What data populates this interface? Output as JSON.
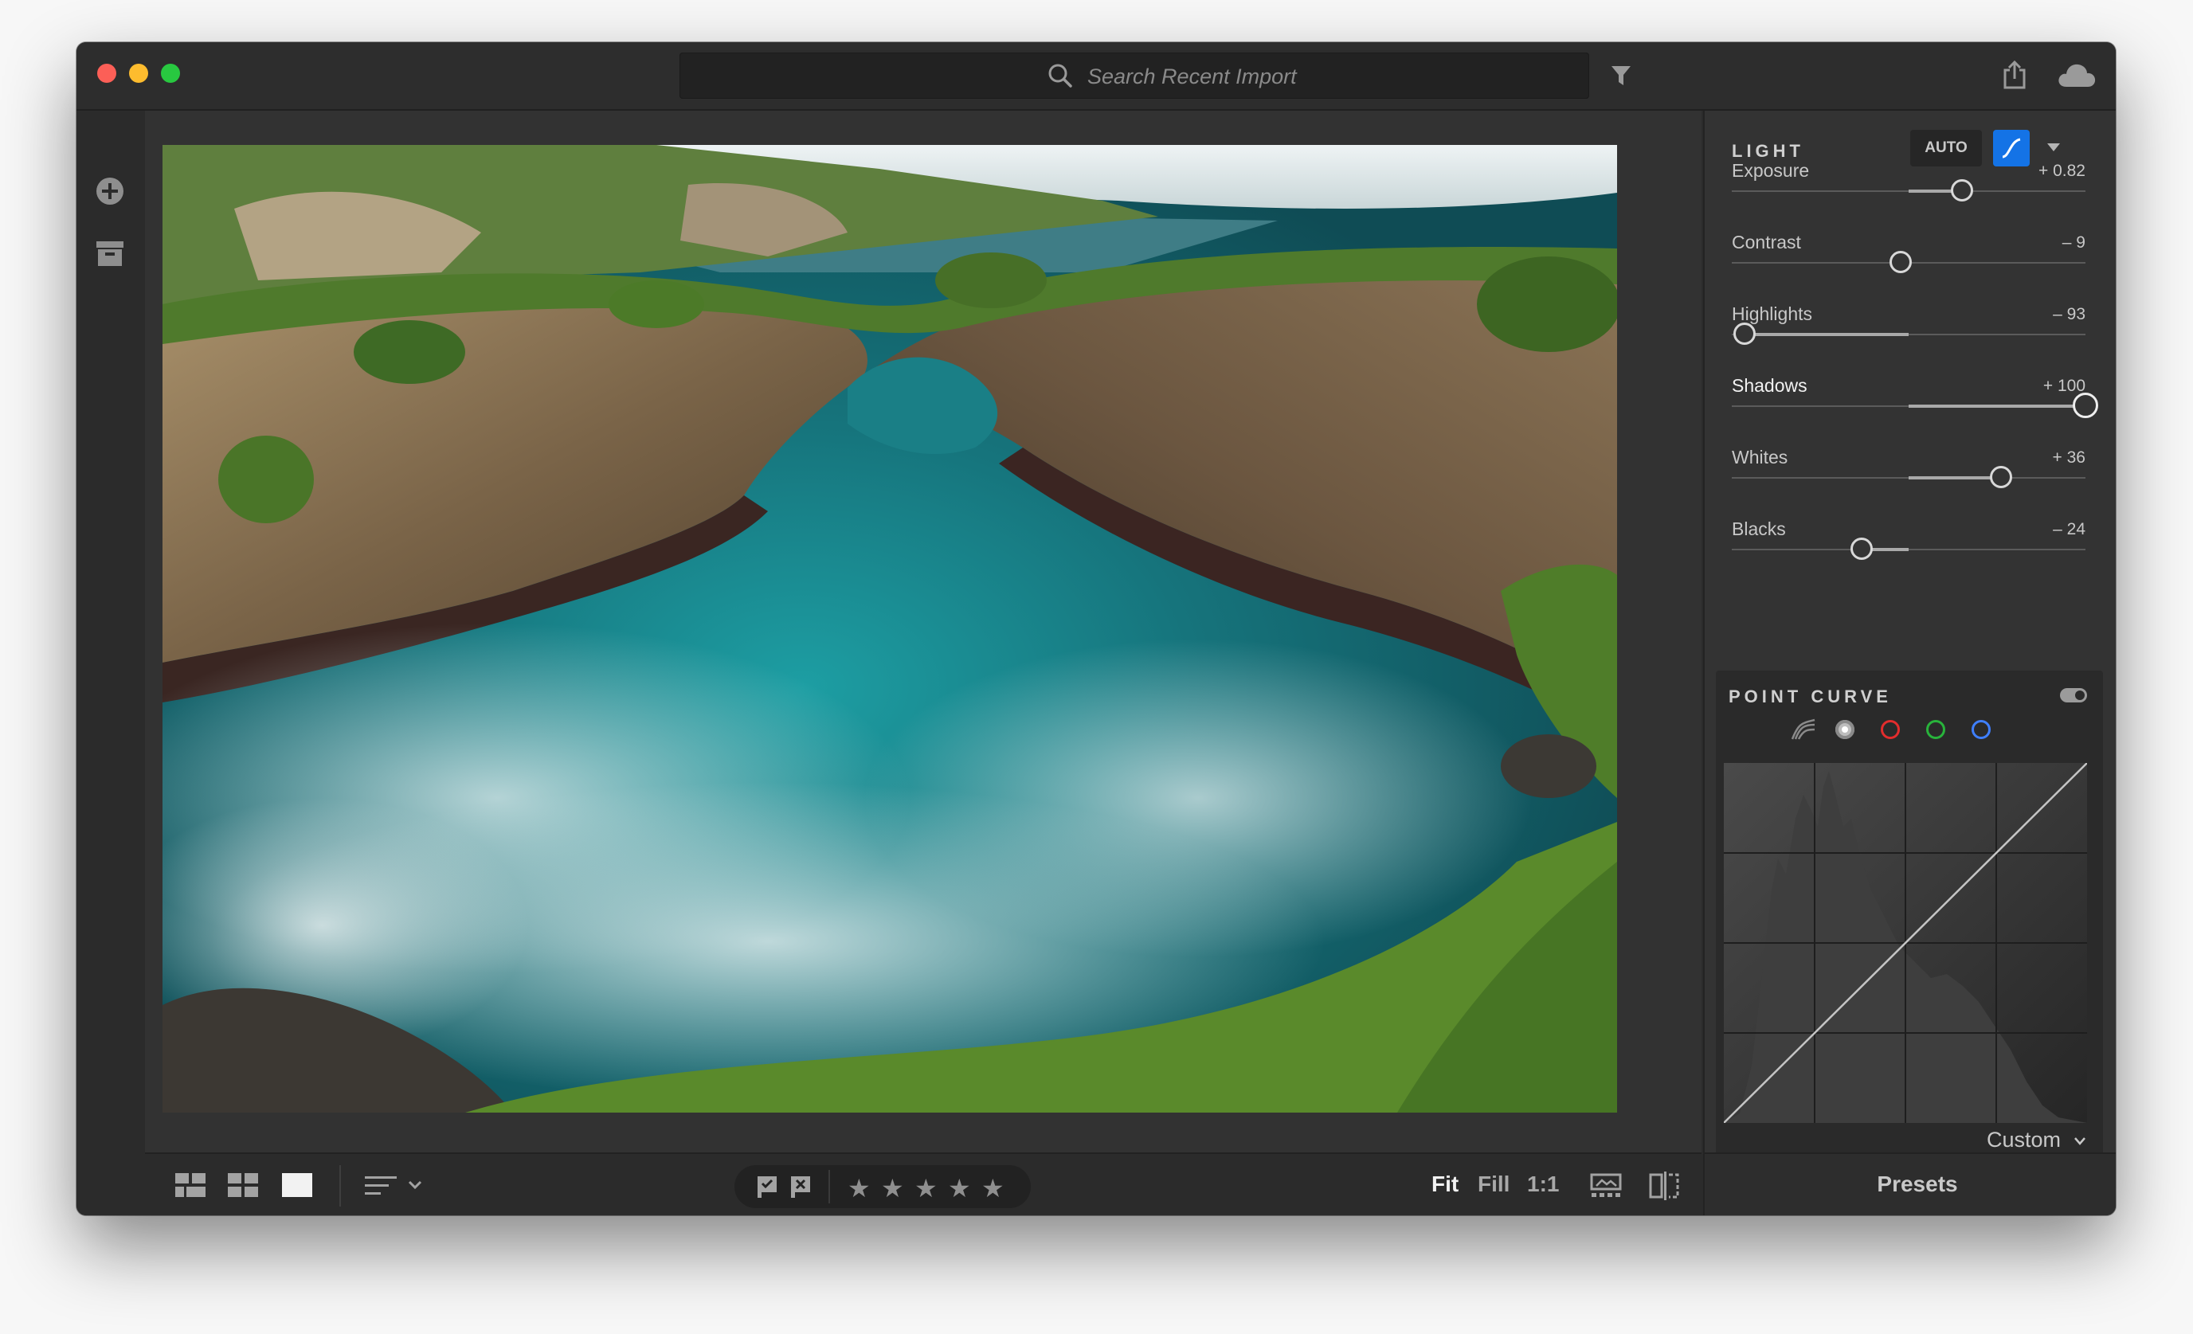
{
  "titlebar": {
    "search_placeholder": "Search Recent Import"
  },
  "icons": {
    "add": "plus-circle-icon",
    "library": "archive-box-icon",
    "filter": "filter-funnel-icon",
    "share": "share-icon",
    "cloud": "cloud-icon"
  },
  "bottombar": {
    "view_modes": [
      "square-grid",
      "photo-grid",
      "detail"
    ],
    "sort_icon": "sort-lines-icon",
    "flags": [
      "picked-flag-icon",
      "rejected-flag-icon"
    ],
    "stars": [
      "★",
      "★",
      "★",
      "★",
      "★"
    ],
    "zoom": {
      "fit": "Fit",
      "fill": "Fill",
      "one_to_one": "1:1"
    }
  },
  "panel": {
    "light": {
      "title": "LIGHT",
      "auto_label": "AUTO",
      "sliders": [
        {
          "label": "Exposure",
          "value": "+ 0.82",
          "position": 0.651
        },
        {
          "label": "Contrast",
          "value": "– 9",
          "position": 0.477
        },
        {
          "label": "Highlights",
          "value": "– 93",
          "position": 0.037
        },
        {
          "label": "Shadows",
          "value": "+ 100",
          "position": 1.0
        },
        {
          "label": "Whites",
          "value": "+ 36",
          "position": 0.762
        },
        {
          "label": "Blacks",
          "value": "– 24",
          "position": 0.367
        }
      ]
    },
    "point_curve": {
      "title": "POINT CURVE",
      "channels": [
        "parametric",
        "rgb",
        "red",
        "green",
        "blue"
      ],
      "preset": "Custom"
    },
    "presets_label": "Presets"
  },
  "colors": {
    "accent": "#1473e6",
    "red_channel": "#e22d2d",
    "green_channel": "#28b33b",
    "blue_channel": "#3f7fff"
  },
  "rightrail": [
    "edit-sliders-icon",
    "crop-icon",
    "healing-bandage-icon",
    "brush-icon",
    "linear-gradient-icon",
    "radial-gradient-icon",
    "more-icon",
    "tag-icon",
    "info-icon"
  ]
}
